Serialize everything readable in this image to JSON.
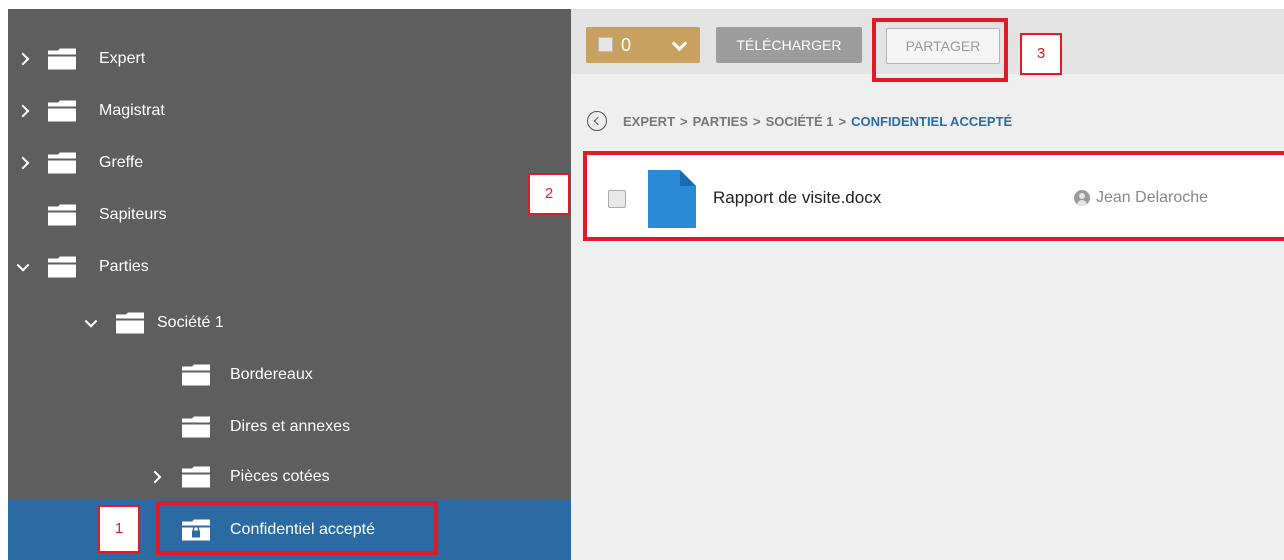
{
  "sidebar": {
    "items": [
      {
        "label": "Expert",
        "expander": "chevron-right",
        "icon": "folder-icon"
      },
      {
        "label": "Magistrat",
        "expander": "chevron-right",
        "icon": "folder-icon"
      },
      {
        "label": "Greffe",
        "expander": "chevron-right",
        "icon": "folder-icon"
      },
      {
        "label": "Sapiteurs",
        "expander": "none",
        "icon": "folder-icon"
      },
      {
        "label": "Parties",
        "expander": "chevron-down",
        "icon": "folder-icon"
      },
      {
        "label": "Société 1",
        "expander": "chevron-down",
        "icon": "folder-icon"
      },
      {
        "label": "Bordereaux",
        "expander": "none",
        "icon": "folder-icon"
      },
      {
        "label": "Dires et annexes",
        "expander": "none",
        "icon": "folder-icon"
      },
      {
        "label": "Pièces cotées",
        "expander": "chevron-right",
        "icon": "folder-icon"
      },
      {
        "label": "Confidentiel accepté",
        "expander": "none",
        "icon": "locked-folder-icon",
        "selected": true
      }
    ]
  },
  "toolbar": {
    "select_count": "0",
    "download_label": "TÉLÉCHARGER",
    "share_label": "PARTAGER"
  },
  "breadcrumb": [
    "EXPERT",
    "PARTIES",
    "SOCIÉTÉ 1",
    "CONFIDENTIEL ACCEPTÉ"
  ],
  "breadcrumb_separator": ">",
  "files": [
    {
      "name": "Rapport de visite.docx",
      "owner": "Jean Delaroche",
      "icon": "document-icon"
    }
  ],
  "annotations": [
    "1",
    "2",
    "3"
  ],
  "colors": {
    "sidebar_bg": "#5e5e5e",
    "selected_bg": "#2c6aa3",
    "accent_gold": "#c8a060",
    "doc_blue": "#2b8ad8",
    "annotation_red": "#e01b24"
  }
}
